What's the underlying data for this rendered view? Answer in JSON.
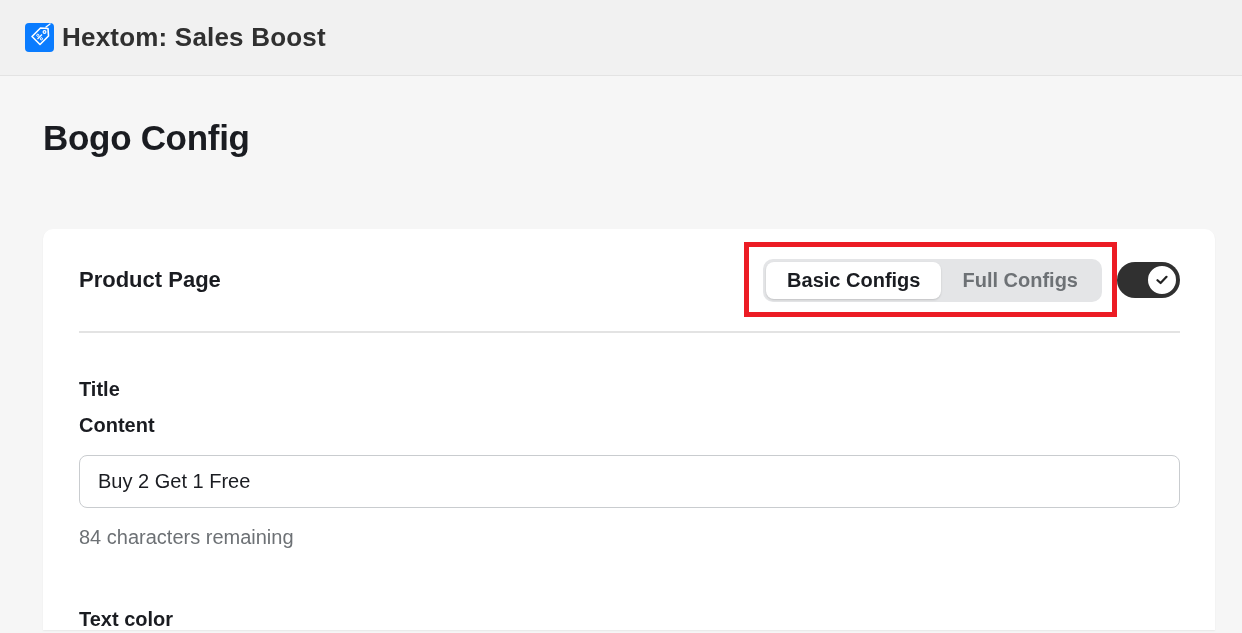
{
  "app_bar": {
    "title": "Hextom: Sales Boost"
  },
  "page": {
    "title": "Bogo Config"
  },
  "card": {
    "title": "Product Page",
    "config_tabs": {
      "highlighted": true,
      "tabs": [
        {
          "label": "Basic Configs",
          "selected": true
        },
        {
          "label": "Full Configs",
          "selected": false
        }
      ]
    },
    "enabled": true,
    "fields": [
      {
        "kind": "heading",
        "label": "Title"
      },
      {
        "kind": "text",
        "label": "Content",
        "value": "Buy 2 Get 1 Free",
        "helper": "84 characters remaining"
      },
      {
        "kind": "heading",
        "label": "Text color"
      }
    ]
  }
}
